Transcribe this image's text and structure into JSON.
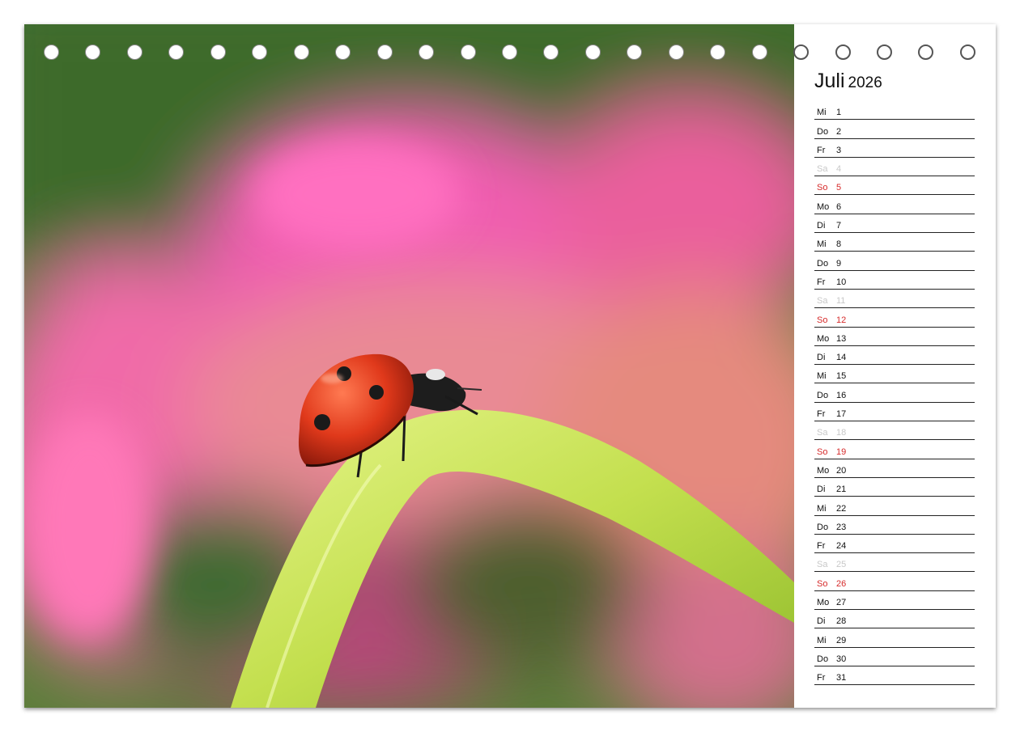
{
  "calendar": {
    "month": "Juli",
    "year": "2026",
    "colors": {
      "weekday": "#111111",
      "saturday": "#c8c8c8",
      "sunday": "#d62b2b"
    },
    "days": [
      {
        "wd": "Mi",
        "d": "1",
        "kind": "weekday"
      },
      {
        "wd": "Do",
        "d": "2",
        "kind": "weekday"
      },
      {
        "wd": "Fr",
        "d": "3",
        "kind": "weekday"
      },
      {
        "wd": "Sa",
        "d": "4",
        "kind": "saturday"
      },
      {
        "wd": "So",
        "d": "5",
        "kind": "sunday"
      },
      {
        "wd": "Mo",
        "d": "6",
        "kind": "weekday"
      },
      {
        "wd": "Di",
        "d": "7",
        "kind": "weekday"
      },
      {
        "wd": "Mi",
        "d": "8",
        "kind": "weekday"
      },
      {
        "wd": "Do",
        "d": "9",
        "kind": "weekday"
      },
      {
        "wd": "Fr",
        "d": "10",
        "kind": "weekday"
      },
      {
        "wd": "Sa",
        "d": "11",
        "kind": "saturday"
      },
      {
        "wd": "So",
        "d": "12",
        "kind": "sunday"
      },
      {
        "wd": "Mo",
        "d": "13",
        "kind": "weekday"
      },
      {
        "wd": "Di",
        "d": "14",
        "kind": "weekday"
      },
      {
        "wd": "Mi",
        "d": "15",
        "kind": "weekday"
      },
      {
        "wd": "Do",
        "d": "16",
        "kind": "weekday"
      },
      {
        "wd": "Fr",
        "d": "17",
        "kind": "weekday"
      },
      {
        "wd": "Sa",
        "d": "18",
        "kind": "saturday"
      },
      {
        "wd": "So",
        "d": "19",
        "kind": "sunday"
      },
      {
        "wd": "Mo",
        "d": "20",
        "kind": "weekday"
      },
      {
        "wd": "Di",
        "d": "21",
        "kind": "weekday"
      },
      {
        "wd": "Mi",
        "d": "22",
        "kind": "weekday"
      },
      {
        "wd": "Do",
        "d": "23",
        "kind": "weekday"
      },
      {
        "wd": "Fr",
        "d": "24",
        "kind": "weekday"
      },
      {
        "wd": "Sa",
        "d": "25",
        "kind": "saturday"
      },
      {
        "wd": "So",
        "d": "26",
        "kind": "sunday"
      },
      {
        "wd": "Mo",
        "d": "27",
        "kind": "weekday"
      },
      {
        "wd": "Di",
        "d": "28",
        "kind": "weekday"
      },
      {
        "wd": "Mi",
        "d": "29",
        "kind": "weekday"
      },
      {
        "wd": "Do",
        "d": "30",
        "kind": "weekday"
      },
      {
        "wd": "Fr",
        "d": "31",
        "kind": "weekday"
      }
    ]
  },
  "photo": {
    "subject": "ladybug-on-grass-blade",
    "colors": {
      "background_green": "#3f6b2a",
      "flower_pink": "#f06ab0",
      "blade": "#c9e35a",
      "ladybug": "#d8351c"
    }
  },
  "binding": {
    "hole_count": 23
  }
}
